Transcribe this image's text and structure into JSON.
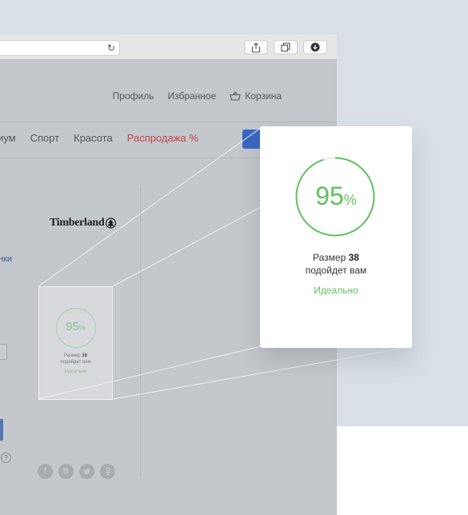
{
  "header": {
    "profile": "Профиль",
    "favorites": "Избранное",
    "cart": "Корзина"
  },
  "nav": {
    "items": [
      "иум",
      "Спорт",
      "Красота"
    ],
    "sale": "Распродажа %"
  },
  "brand": "Timberland",
  "link_tail": "нки",
  "socials": [
    "f",
    "B",
    "t",
    "ok"
  ],
  "help": "?",
  "widget": {
    "percent": "95",
    "percent_sign": "%",
    "size_prefix": "Размер",
    "size_value": "38",
    "fit_text": "подойдет вам",
    "verdict": "Идеально",
    "accent_color": "#5fc25f",
    "progress": 0.95
  }
}
